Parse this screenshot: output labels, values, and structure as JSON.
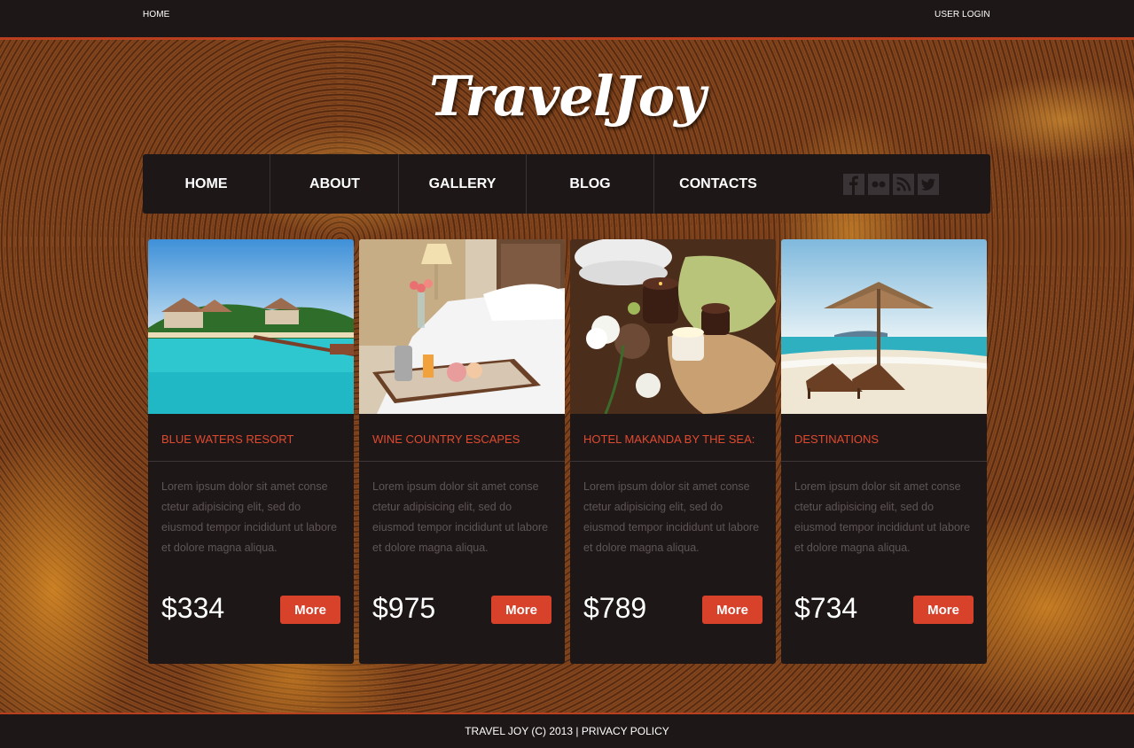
{
  "topbar": {
    "home": "HOME",
    "login": "USER LOGIN"
  },
  "logo": "TravelJoy",
  "nav": {
    "items": [
      {
        "label": "HOME"
      },
      {
        "label": "ABOUT"
      },
      {
        "label": "GALLERY"
      },
      {
        "label": "BLOG"
      },
      {
        "label": "CONTACTS"
      }
    ],
    "social": [
      "facebook-icon",
      "flickr-icon",
      "rss-icon",
      "twitter-icon"
    ]
  },
  "cards": [
    {
      "title": "BLUE WATERS RESORT",
      "desc": "Lorem ipsum dolor sit amet conse ctetur adipisicing elit, sed do eiusmod tempor incididunt ut labore et dolore magna aliqua.",
      "price": "$334",
      "button": "More"
    },
    {
      "title": "WINE COUNTRY ESCAPES",
      "desc": "Lorem ipsum dolor sit amet conse ctetur adipisicing elit, sed do eiusmod tempor incididunt ut labore et dolore magna aliqua.",
      "price": "$975",
      "button": "More"
    },
    {
      "title": "HOTEL MAKANDA BY THE SEA:",
      "desc": "Lorem ipsum dolor sit amet conse ctetur adipisicing elit, sed do eiusmod tempor incididunt ut labore et dolore magna aliqua.",
      "price": "$789",
      "button": "More"
    },
    {
      "title": "DESTINATIONS",
      "desc": "Lorem ipsum dolor sit amet conse ctetur adipisicing elit, sed do eiusmod tempor incididunt ut labore et dolore magna aliqua.",
      "price": "$734",
      "button": "More"
    }
  ],
  "footer": {
    "copyright": "TRAVEL JOY (C) 2013",
    "separator": "|",
    "privacy": "PRIVACY POLICY"
  },
  "colors": {
    "accent": "#d8412a",
    "title": "#e04a2f",
    "panel": "#1e1718",
    "border": "#b8401f"
  }
}
